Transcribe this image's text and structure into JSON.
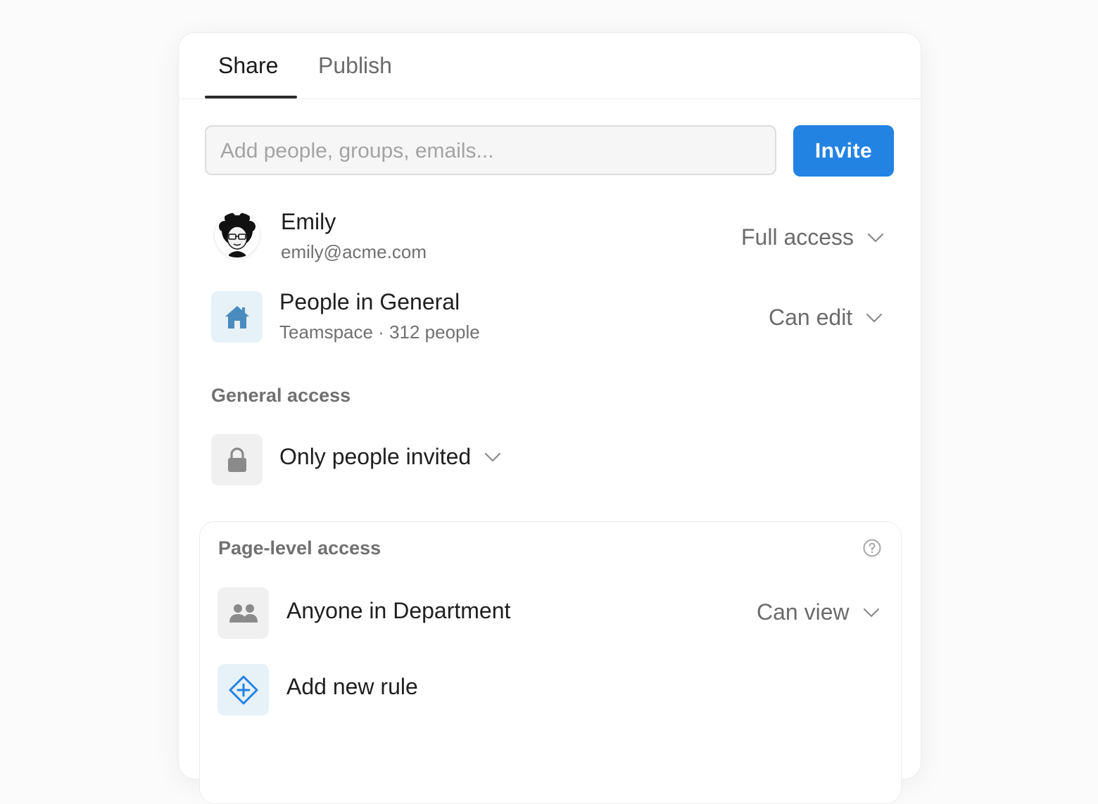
{
  "tabs": [
    {
      "label": "Share",
      "active": true
    },
    {
      "label": "Publish",
      "active": false
    }
  ],
  "search": {
    "placeholder": "Add people, groups, emails...",
    "value": ""
  },
  "invite_label": "Invite",
  "members": [
    {
      "name": "Emily",
      "subtitle": "emily@acme.com",
      "permission": "Full access",
      "icon": "avatar"
    },
    {
      "name": "People in General",
      "subtitle": "Teamspace · 312 people",
      "permission": "Can edit",
      "icon": "house-icon"
    }
  ],
  "general_access": {
    "label": "General access",
    "value": "Only people invited",
    "icon": "lock-icon"
  },
  "page_level": {
    "label": "Page-level access",
    "rules": [
      {
        "name": "Anyone in Department",
        "permission": "Can view",
        "icon": "people-icon"
      }
    ],
    "add_rule_label": "Add new rule"
  },
  "colors": {
    "accent": "#2383e2",
    "house_tile": "#e6f1f8",
    "house_icon": "#4a8bc0",
    "neutral_tile": "#f0f0f0",
    "neutral_icon": "#8a8a8a"
  }
}
